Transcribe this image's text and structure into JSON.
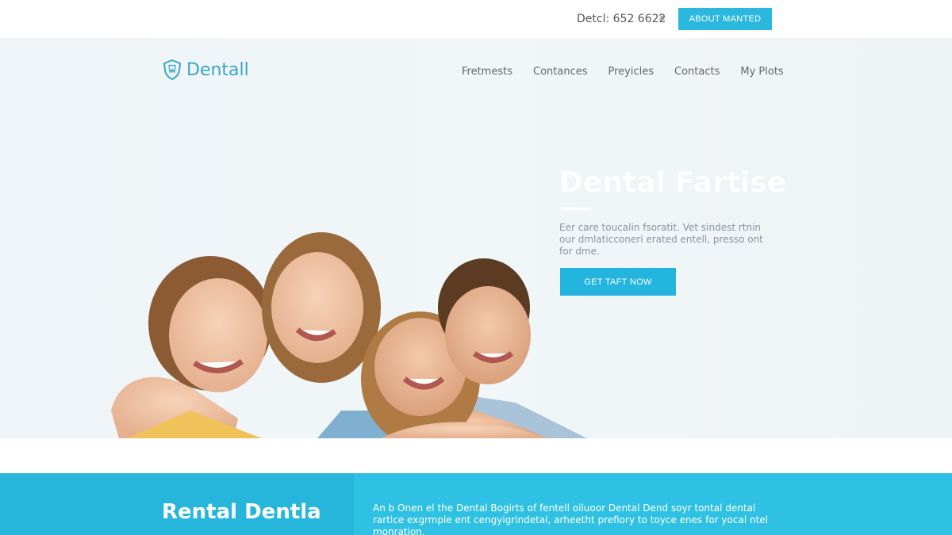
{
  "topbar": {
    "phone": "Detcl: 652 6622",
    "close_symbol": "×",
    "about_button": "ABOUT MANTED"
  },
  "header": {
    "logo_text": "Dentall",
    "logo_icon": "shield-tooth-icon",
    "nav": [
      "Fretmests",
      "Contances",
      "Preyicles",
      "Contacts",
      "My Plots"
    ]
  },
  "hero": {
    "title": "Dental Fartise",
    "description": "Eer care toucalin fsoratit. Vet sindest rtnin our dmlaticconeri erated entell, presso ont for dme.",
    "cta_button": "GET TAFT NOW",
    "photo_alt": "family-photo"
  },
  "band": {
    "title": "Rental Dentla",
    "text": "An b Onen el the Dental Bogirts of fentell oiluoor Dental Dend soyr tontal dental rartice exgrmple ent cengyigrindetal, arheetht prefiory to toyce enes for yocal ntel monration."
  },
  "colors": {
    "accent": "#2bb8df",
    "band": "#2fc1e3",
    "logo": "#3aa6c6"
  }
}
